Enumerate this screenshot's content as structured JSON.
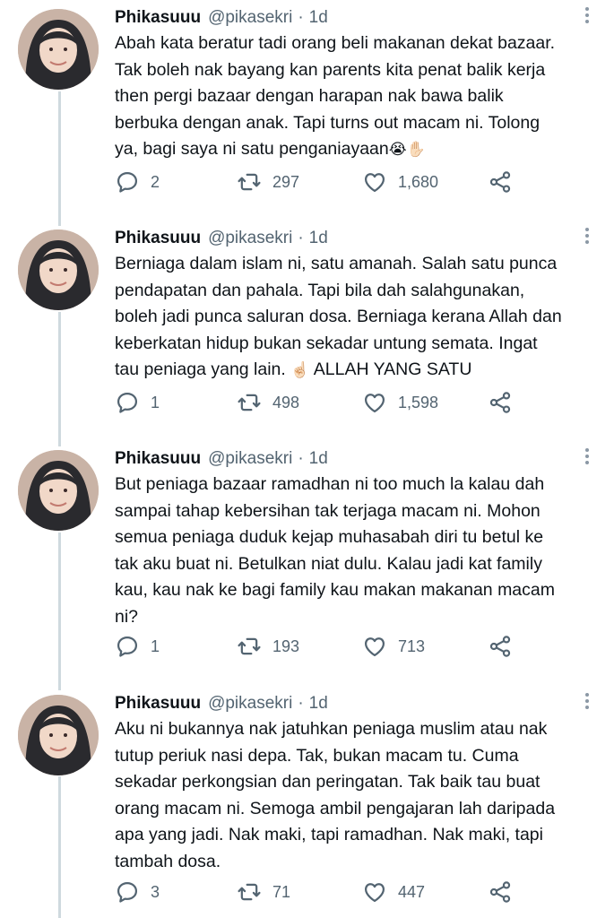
{
  "tweets": [
    {
      "name": "Phikasuuu",
      "handle": "@pikasekri",
      "separator": "·",
      "time": "1d",
      "text": "Abah kata beratur tadi orang beli makanan dekat bazaar.\nTak boleh nak bayang kan parents kita penat balik kerja\nthen pergi bazaar dengan harapan nak bawa balik\nberbuka dengan anak. Tapi turns out macam ni. Tolong\nya, bagi saya ni satu penganiayaan",
      "emoji": "😭✋🏻",
      "replies": "2",
      "retweets": "297",
      "likes": "1,680"
    },
    {
      "name": "Phikasuuu",
      "handle": "@pikasekri",
      "separator": "·",
      "time": "1d",
      "text": "Berniaga dalam islam ni, satu amanah. Salah satu punca\npendapatan dan pahala. Tapi bila dah salahgunakan,\nboleh jadi punca saluran dosa. Berniaga kerana Allah dan\nkeberkatan hidup bukan sekadar untung semata. Ingat\ntau peniaga yang lain.",
      "emoji": "☝🏻",
      "text_suffix": "ALLAH YANG SATU",
      "replies": "1",
      "retweets": "498",
      "likes": "1,598"
    },
    {
      "name": "Phikasuuu",
      "handle": "@pikasekri",
      "separator": "·",
      "time": "1d",
      "text": "But peniaga bazaar ramadhan ni too much la kalau dah\nsampai tahap kebersihan tak terjaga macam ni. Mohon\nsemua peniaga duduk kejap muhasabah diri tu betul ke\ntak aku buat ni. Betulkan niat dulu. Kalau jadi kat family\nkau, kau nak ke bagi family kau makan makanan macam\nni?",
      "replies": "1",
      "retweets": "193",
      "likes": "713"
    },
    {
      "name": "Phikasuuu",
      "handle": "@pikasekri",
      "separator": "·",
      "time": "1d",
      "text": "Aku ni bukannya nak jatuhkan peniaga muslim atau nak\ntutup periuk nasi depa. Tak, bukan macam tu. Cuma\nsekadar perkongsian dan peringatan. Tak baik tau buat\norang macam ni. Semoga ambil pengajaran lah daripada\napa yang jadi. Nak maki, tapi ramadhan. Nak maki, tapi\ntambah dosa.",
      "replies": "3",
      "retweets": "71",
      "likes": "447"
    }
  ],
  "icons": {
    "reply": "reply-icon",
    "retweet": "retweet-icon",
    "like": "heart-icon",
    "share": "share-icon",
    "more": "more-options-icon"
  },
  "colors": {
    "text": "#0f1419",
    "secondary": "#536471",
    "thread_line": "#cfd9de"
  }
}
